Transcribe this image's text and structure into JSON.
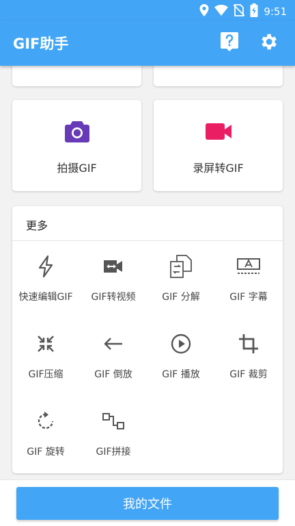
{
  "status_bar": {
    "time": "9:51"
  },
  "app_bar": {
    "title": "GIF助手"
  },
  "tiles": [
    {
      "label": "拍摄GIF",
      "icon": "camera-icon",
      "color": "#673ab7"
    },
    {
      "label": "录屏转GIF",
      "icon": "video-camera-icon",
      "color": "#e91e63"
    }
  ],
  "more": {
    "title": "更多",
    "items": [
      {
        "label": "快速编辑GIF",
        "icon": "lightning-icon"
      },
      {
        "label": "GIF转视频",
        "icon": "video-convert-icon"
      },
      {
        "label": "GIF 分解",
        "icon": "split-icon"
      },
      {
        "label": "GIF 字幕",
        "icon": "subtitle-icon"
      },
      {
        "label": "GIF压缩",
        "icon": "compress-icon"
      },
      {
        "label": "GIF 倒放",
        "icon": "reverse-arrow-icon"
      },
      {
        "label": "GIF 播放",
        "icon": "play-circle-icon"
      },
      {
        "label": "GIF 裁剪",
        "icon": "crop-icon"
      },
      {
        "label": "GIF 旋转",
        "icon": "rotate-icon"
      },
      {
        "label": "GIF拼接",
        "icon": "join-icon"
      }
    ]
  },
  "bottom": {
    "button_label": "我的文件"
  },
  "colors": {
    "primary": "#42a5f5",
    "background": "#f2f2f2",
    "icon_gray": "#555555"
  }
}
